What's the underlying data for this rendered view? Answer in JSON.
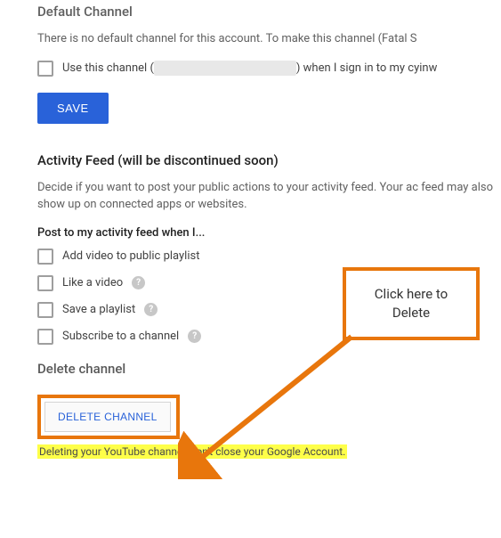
{
  "sections": {
    "default_channel": {
      "title": "Default Channel",
      "description_prefix": "There is no default channel for this account. To make this channel (Fatal S",
      "checkbox_prefix": "Use this channel (",
      "checkbox_suffix": ") when I sign in to my cyinw",
      "save_label": "SAVE"
    },
    "activity_feed": {
      "title": "Activity Feed (will be discontinued soon)",
      "description": "Decide if you want to post your public actions to your activity feed. Your ac feed may also show up on connected apps or websites.",
      "sub_title": "Post to my activity feed when I...",
      "options": [
        "Add video to public playlist",
        "Like a video",
        "Save a playlist",
        "Subscribe to a channel"
      ]
    },
    "delete_channel": {
      "title": "Delete channel",
      "button_label": "DELETE CHANNEL",
      "warning": "Deleting your YouTube channel won't close your Google Account."
    }
  },
  "callout": {
    "text": "Click here to Delete"
  },
  "colors": {
    "accent_orange": "#e8760c",
    "primary_blue": "#2962d9",
    "highlight_yellow": "#feff49"
  }
}
